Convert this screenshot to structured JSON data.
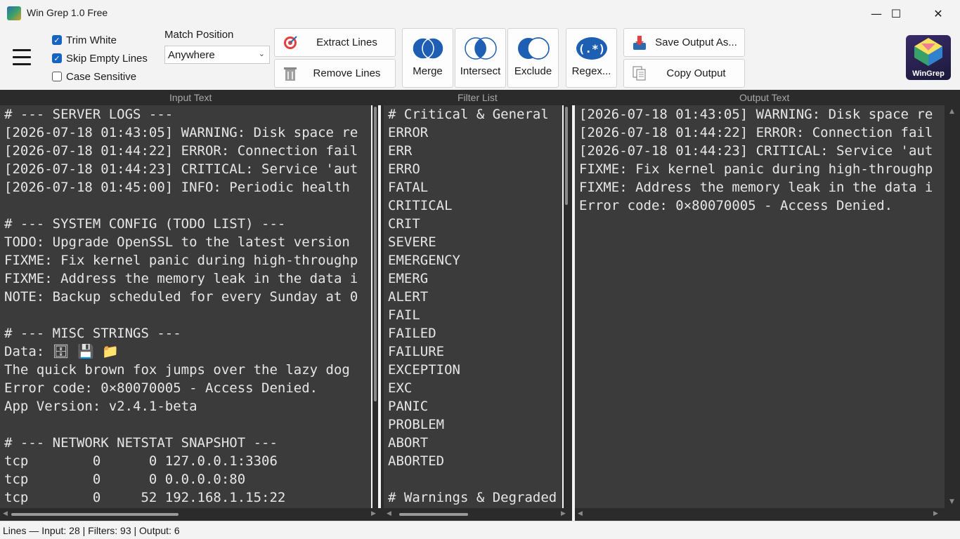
{
  "window": {
    "title": "Win Grep 1.0 Free",
    "minimize": "—",
    "maximize": "☐",
    "close": "✕"
  },
  "options": {
    "trim_white": {
      "label": "Trim White",
      "checked": true
    },
    "skip_empty": {
      "label": "Skip Empty Lines",
      "checked": true
    },
    "case_sensitive": {
      "label": "Case Sensitive",
      "checked": false
    },
    "match_position_label": "Match Position",
    "match_position_value": "Anywhere"
  },
  "toolbar": {
    "extract_lines": "Extract Lines",
    "remove_lines": "Remove Lines",
    "merge": "Merge",
    "intersect": "Intersect",
    "exclude": "Exclude",
    "regex": "Regex...",
    "save_output": "Save Output As...",
    "copy_output": "Copy Output",
    "logo_text": "WinGrep"
  },
  "panels": {
    "input_title": "Input Text",
    "filter_title": "Filter List",
    "output_title": "Output Text"
  },
  "input_lines": [
    "# --- SERVER LOGS ---",
    "[2026-07-18 01:43:05] WARNING: Disk space re",
    "[2026-07-18 01:44:22] ERROR: Connection fail",
    "[2026-07-18 01:44:23] CRITICAL: Service 'aut",
    "[2026-07-18 01:45:00] INFO: Periodic health",
    "",
    "# --- SYSTEM CONFIG (TODO LIST) ---",
    "TODO: Upgrade OpenSSL to the latest version",
    "FIXME: Fix kernel panic during high-throughp",
    "FIXME: Address the memory leak in the data i",
    "NOTE: Backup scheduled for every Sunday at 0",
    "",
    "# --- MISC STRINGS ---",
    "Data: 🗄 💾 📁",
    "The quick brown fox jumps over the lazy dog",
    "Error code: 0×80070005 - Access Denied.",
    "App Version: v2.4.1-beta",
    "",
    "# --- NETWORK NETSTAT SNAPSHOT ---",
    "tcp        0      0 127.0.0.1:3306",
    "tcp        0      0 0.0.0.0:80",
    "tcp        0     52 192.168.1.15:22"
  ],
  "filter_lines": [
    "# Critical & General",
    "ERROR",
    "ERR",
    "ERRO",
    "FATAL",
    "CRITICAL",
    "CRIT",
    "SEVERE",
    "EMERGENCY",
    "EMERG",
    "ALERT",
    "FAIL",
    "FAILED",
    "FAILURE",
    "EXCEPTION",
    "EXC",
    "PANIC",
    "PROBLEM",
    "ABORT",
    "ABORTED",
    "",
    "# Warnings & Degraded"
  ],
  "output_lines": [
    "[2026-07-18 01:43:05] WARNING: Disk space re",
    "[2026-07-18 01:44:22] ERROR: Connection fail",
    "[2026-07-18 01:44:23] CRITICAL: Service 'aut",
    "FIXME: Fix kernel panic during high-throughp",
    "FIXME: Address the memory leak in the data i",
    "Error code: 0×80070005 - Access Denied."
  ],
  "status": {
    "text": "Lines — Input: 28  |  Filters: 93  |  Output: 6"
  },
  "colors": {
    "panel_bg": "#3b3b3b",
    "panel_text": "#e6e6e6",
    "accent": "#1565c0"
  }
}
